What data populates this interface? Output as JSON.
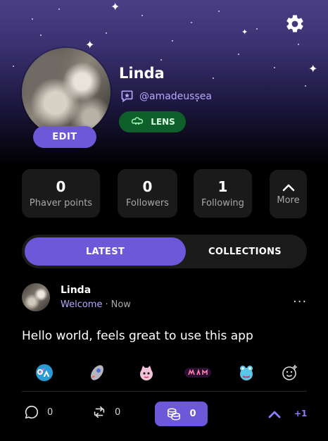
{
  "header": {
    "settings_icon": "gear-icon"
  },
  "profile": {
    "name": "Linda",
    "handle": "@amadeussea",
    "edit_label": "EDIT",
    "lens_label": "LENS"
  },
  "stats": [
    {
      "value": "0",
      "label": "Phaver points"
    },
    {
      "value": "0",
      "label": "Followers"
    },
    {
      "value": "1",
      "label": "Following"
    }
  ],
  "more": {
    "label": "More",
    "icon": "chevron-up-icon"
  },
  "tabs": [
    {
      "label": "LATEST",
      "active": true
    },
    {
      "label": "COLLECTIONS",
      "active": false
    }
  ],
  "post": {
    "author": "Linda",
    "community": "Welcome",
    "separator": "·",
    "time": "Now",
    "menu": "···",
    "text": "Hello world, feels great to use this app",
    "reactions": [
      "gm-sticker",
      "rocket-sticker",
      "cat-sticker",
      "wagmi-sticker",
      "frog-sticker",
      "add-reaction-icon"
    ],
    "comment_count": "0",
    "repost_count": "0",
    "coin_count": "0",
    "plus_count": "+1"
  },
  "colors": {
    "accent": "#6c58d8",
    "handle": "#b8a8ff",
    "lens_bg": "#0f5f2a"
  }
}
